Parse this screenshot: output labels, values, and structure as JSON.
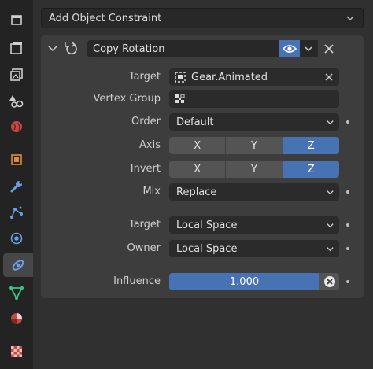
{
  "header": {
    "add_constraint_label": "Add Object Constraint"
  },
  "constraint": {
    "name": "Copy Rotation",
    "target_label": "Target",
    "target_value": "Gear.Animated",
    "vertex_group_label": "Vertex Group",
    "vertex_group_value": "",
    "order_label": "Order",
    "order_value": "Default",
    "axis_label": "Axis",
    "axis": [
      {
        "label": "X",
        "active": false
      },
      {
        "label": "Y",
        "active": false
      },
      {
        "label": "Z",
        "active": true
      }
    ],
    "invert_label": "Invert",
    "invert": [
      {
        "label": "X",
        "active": false
      },
      {
        "label": "Y",
        "active": false
      },
      {
        "label": "Z",
        "active": true
      }
    ],
    "mix_label": "Mix",
    "mix_value": "Replace",
    "target_space_label": "Target",
    "target_space_value": "Local Space",
    "owner_space_label": "Owner",
    "owner_space_value": "Local Space",
    "influence_label": "Influence",
    "influence_value": "1.000"
  },
  "sidebar": {
    "tabs": [
      {
        "icon": "tool-icon"
      },
      {
        "icon": "render-icon"
      },
      {
        "icon": "output-icon"
      },
      {
        "icon": "view-layer-icon"
      },
      {
        "icon": "scene-icon"
      },
      {
        "icon": "world-icon"
      },
      {
        "icon": "object-icon"
      },
      {
        "icon": "modifier-wrench-icon"
      },
      {
        "icon": "particles-icon"
      },
      {
        "icon": "physics-icon"
      },
      {
        "icon": "object-constraint-icon",
        "active": true
      },
      {
        "icon": "object-data-icon"
      },
      {
        "icon": "material-icon"
      },
      {
        "icon": "texture-icon"
      }
    ]
  },
  "colors": {
    "accent": "#4772b3",
    "panel": "#3d3d3d",
    "field": "#2b2b2b",
    "background": "#303030"
  }
}
